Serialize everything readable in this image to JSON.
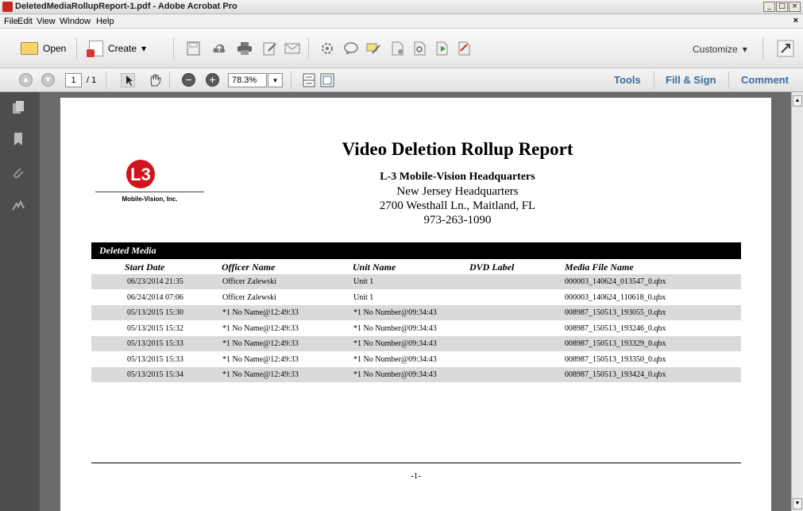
{
  "window": {
    "title": "DeletedMediaRollupReport-1.pdf - Adobe Acrobat Pro",
    "controls": [
      "_",
      "□",
      "×"
    ]
  },
  "menu": {
    "items": [
      "File",
      "Edit",
      "View",
      "Window",
      "Help"
    ],
    "close": "×"
  },
  "toolbar": {
    "open_label": "Open",
    "create_label": "Create",
    "customize_label": "Customize",
    "dropdown_glyph": "▾"
  },
  "nav": {
    "page_current": "1",
    "page_total": "/ 1",
    "zoom": "78.3%",
    "tools_label": "Tools",
    "fill_sign_label": "Fill & Sign",
    "comment_label": "Comment"
  },
  "document": {
    "logo_text": "L3",
    "logo_company": "Mobile-Vision, Inc.",
    "title": "Video Deletion Rollup Report",
    "org": "L-3 Mobile-Vision Headquarters",
    "location": "New Jersey Headquarters",
    "address": "2700 Westhall Ln., Maitland, FL",
    "phone": "973-263-1090",
    "section": "Deleted Media",
    "columns": [
      "Start Date",
      "Officer Name",
      "Unit Name",
      "DVD Label",
      "Media File Name"
    ],
    "rows": [
      {
        "start": "06/23/2014 21:35",
        "officer": "Officer Zalewski",
        "unit": "Unit 1",
        "dvd": "",
        "file": "000003_140624_013547_0.qbx"
      },
      {
        "start": "06/24/2014 07:06",
        "officer": "Officer Zalewski",
        "unit": "Unit 1",
        "dvd": "",
        "file": "000003_140624_110618_0.qbx"
      },
      {
        "start": "05/13/2015 15:30",
        "officer": "*1 No Name@12:49:33",
        "unit": "*1 No Number@09:34:43",
        "dvd": "",
        "file": "008987_150513_193055_0.qbx"
      },
      {
        "start": "05/13/2015 15:32",
        "officer": "*1 No Name@12:49:33",
        "unit": "*1 No Number@09:34:43",
        "dvd": "",
        "file": "008987_150513_193246_0.qbx"
      },
      {
        "start": "05/13/2015 15:33",
        "officer": "*1 No Name@12:49:33",
        "unit": "*1 No Number@09:34:43",
        "dvd": "",
        "file": "008987_150513_193329_0.qbx"
      },
      {
        "start": "05/13/2015 15:33",
        "officer": "*1 No Name@12:49:33",
        "unit": "*1 No Number@09:34:43",
        "dvd": "",
        "file": "008987_150513_193350_0.qbx"
      },
      {
        "start": "05/13/2015 15:34",
        "officer": "*1 No Name@12:49:33",
        "unit": "*1 No Number@09:34:43",
        "dvd": "",
        "file": "008987_150513_193424_0.qbx"
      }
    ],
    "page_footer": "-1-"
  },
  "colors": {
    "accent": "#3c6b9e",
    "logo_red": "#d0131c",
    "row_shade": "#dadada"
  }
}
